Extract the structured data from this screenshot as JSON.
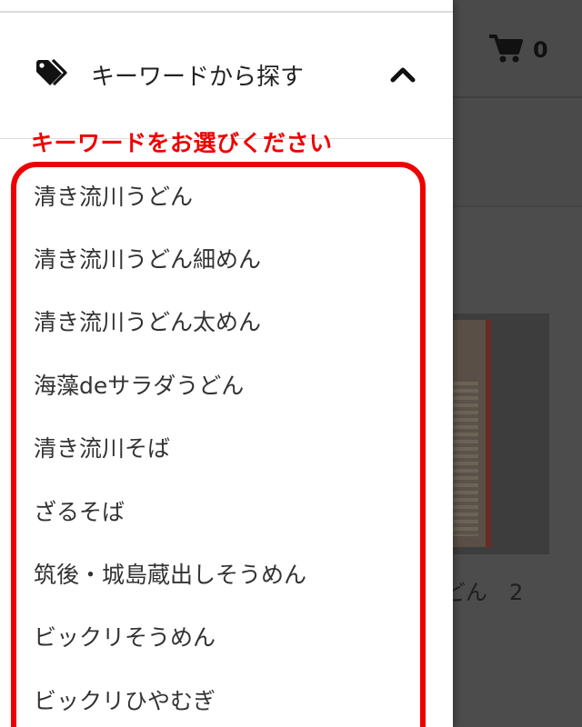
{
  "cart": {
    "icon": "cart-icon",
    "count": "0"
  },
  "background_product": {
    "name_fragment": "どん　2"
  },
  "drawer": {
    "section_icon": "tag-icon",
    "section_title": "キーワードから探す",
    "toggle_icon": "chevron-up-icon"
  },
  "annotation": {
    "text": "キーワードをお選びください",
    "color": "#ee0000"
  },
  "keywords": [
    "清き流川うどん",
    "清き流川うどん細めん",
    "清き流川うどん太めん",
    "海藻deサラダうどん",
    "清き流川そば",
    "ざるそば",
    "筑後・城島蔵出しそうめん",
    "ビックリそうめん",
    "ビックリひやむぎ"
  ]
}
